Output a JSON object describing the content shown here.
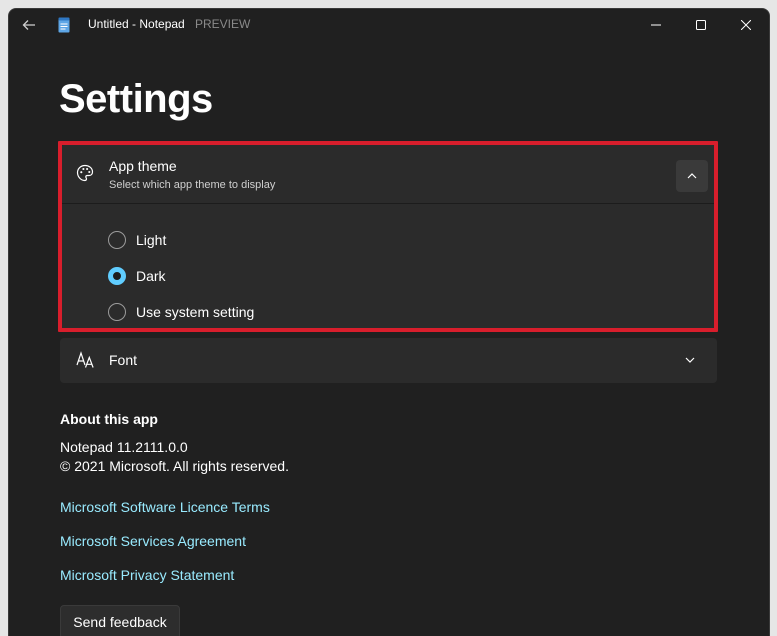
{
  "titlebar": {
    "app_title": "Untitled - Notepad",
    "badge": "PREVIEW",
    "icons": {
      "back": "back-arrow-icon",
      "app": "notepad-icon",
      "minimize": "minimize-icon",
      "maximize": "maximize-icon",
      "close": "close-icon"
    }
  },
  "page": {
    "title": "Settings"
  },
  "app_theme": {
    "title": "App theme",
    "subtitle": "Select which app theme to display",
    "icon": "palette-icon",
    "expanded": true,
    "options": [
      {
        "label": "Light",
        "selected": false
      },
      {
        "label": "Dark",
        "selected": true
      },
      {
        "label": "Use system setting",
        "selected": false
      }
    ]
  },
  "font": {
    "title": "Font",
    "icon": "font-icon",
    "expanded": false
  },
  "about": {
    "heading": "About this app",
    "version": "Notepad 11.2111.0.0",
    "copyright": "© 2021 Microsoft. All rights reserved.",
    "links": [
      "Microsoft Software Licence Terms",
      "Microsoft Services Agreement",
      "Microsoft Privacy Statement"
    ],
    "feedback_button": "Send feedback"
  },
  "colors": {
    "background": "#202020",
    "card": "#2b2b2b",
    "accent": "#60cdff",
    "link": "#99ebff",
    "highlight": "#d81e2c"
  }
}
